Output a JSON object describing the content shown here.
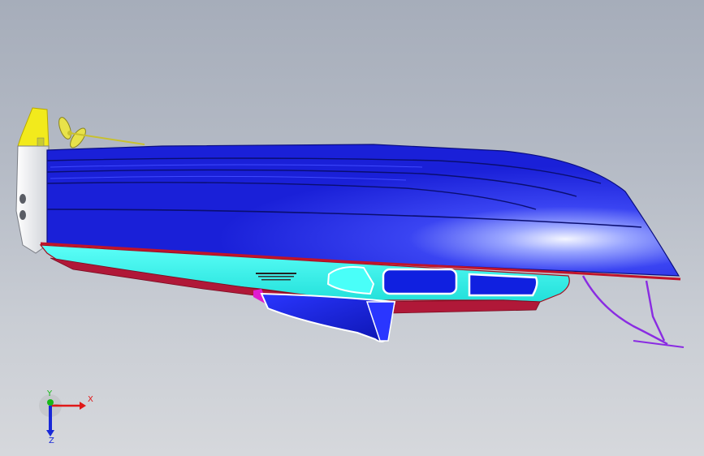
{
  "viewport": {
    "background_top": "#a6adba",
    "background_bottom": "#d6d8dc"
  },
  "model": {
    "deck_color": "#1a20d8",
    "deck_highlight": "#eef2ff",
    "hull_color": "#33f5ee",
    "waterline_color": "#c0142a",
    "window_color": "#1020e0",
    "transom_color": "#f2f2f2",
    "rudder_color": "#f2ea1c",
    "strut_color": "#8a2be2",
    "fin_accent_color": "#e01ccf",
    "hull_lettering_icon": "hull-text-decal-icon"
  },
  "triad": {
    "x_label": "X",
    "y_label": "Y",
    "z_label": "Z",
    "x_color": "#e01818",
    "y_color": "#18b818",
    "z_color": "#1828d8"
  }
}
